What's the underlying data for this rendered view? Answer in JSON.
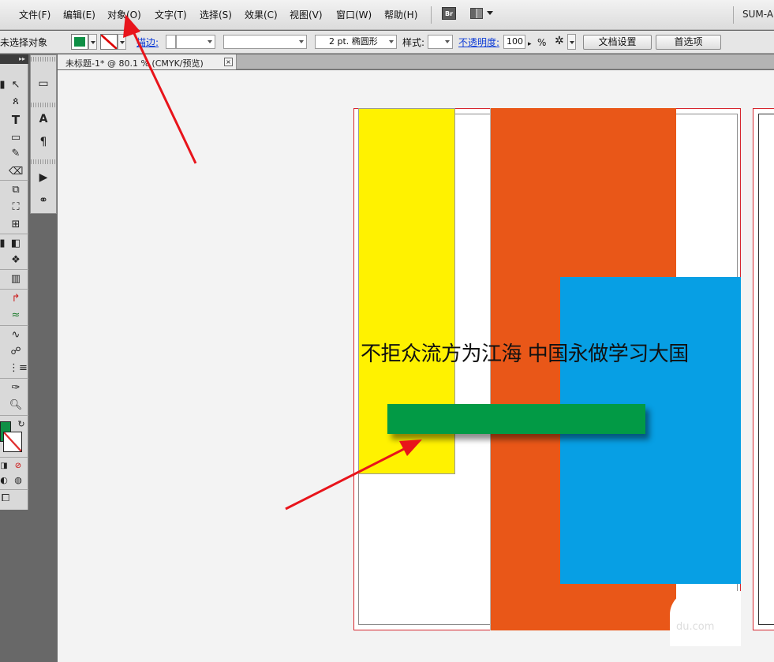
{
  "menubar": {
    "items": [
      "文件(F)",
      "编辑(E)",
      "对象(O)",
      "文字(T)",
      "选择(S)",
      "效果(C)",
      "视图(V)",
      "窗口(W)",
      "帮助(H)"
    ],
    "bridge_label": "Br",
    "app_title": "SUM-A"
  },
  "controlbar": {
    "selection_status": "未选择对象",
    "fill_color": "#0e8f45",
    "stroke_label": "描边:",
    "brush_value": "2 pt. 椭圆形",
    "style_label": "样式:",
    "opacity_label": "不透明度:",
    "opacity_value": "100",
    "percent": "%",
    "doc_setup_button": "文档设置",
    "preferences_button": "首选项"
  },
  "tools": {
    "text_tool_glyph": "T",
    "paragraph_glyph": "¶",
    "type_glyph": "A"
  },
  "document": {
    "tab_label": "未标题-1* @ 80.1 % (CMYK/预览)",
    "close_glyph": "×"
  },
  "artwork": {
    "text": "不拒众流方为江海 中国永做学习大国",
    "watermark": "du.com",
    "colors": {
      "yellow": "#fff200",
      "orange": "#e95718",
      "blue": "#079fe4",
      "green": "#029a45",
      "arrow": "#e8141b"
    }
  }
}
